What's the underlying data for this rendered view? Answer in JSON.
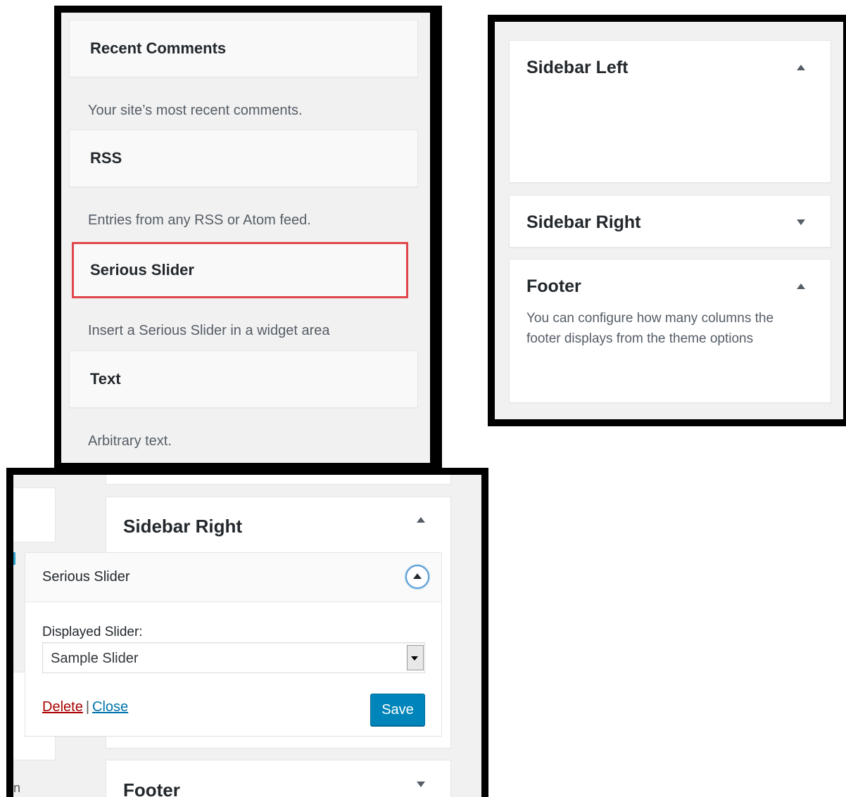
{
  "available_widgets": [
    {
      "title": "Recent Comments",
      "description": "Your site’s most recent comments."
    },
    {
      "title": "RSS",
      "description": "Entries from any RSS or Atom feed."
    },
    {
      "title": "Serious Slider",
      "description": "Insert a Serious Slider in a widget area"
    },
    {
      "title": "Text",
      "description": "Arbitrary text."
    }
  ],
  "widget_areas": {
    "sidebar_left": {
      "title": "Sidebar Left",
      "toggle": "expanded"
    },
    "sidebar_right": {
      "title": "Sidebar Right",
      "toggle": "collapsed"
    },
    "footer": {
      "title": "Footer",
      "toggle": "expanded",
      "description": "You can configure how many columns the footer displays from the theme options"
    }
  },
  "widget_form": {
    "area_title": "Sidebar Right",
    "widget_title": "Serious Slider",
    "field_label": "Displayed Slider:",
    "selected_slider": "Sample Slider",
    "delete_label": "Delete",
    "separator": "|",
    "close_label": "Close",
    "save_label": "Save",
    "footer_title": "Footer",
    "edge_text": "n"
  },
  "colors": {
    "highlight_border": "#e0474c",
    "save_button": "#0085ba",
    "delete_link": "#aa0000",
    "close_link": "#0073aa"
  }
}
